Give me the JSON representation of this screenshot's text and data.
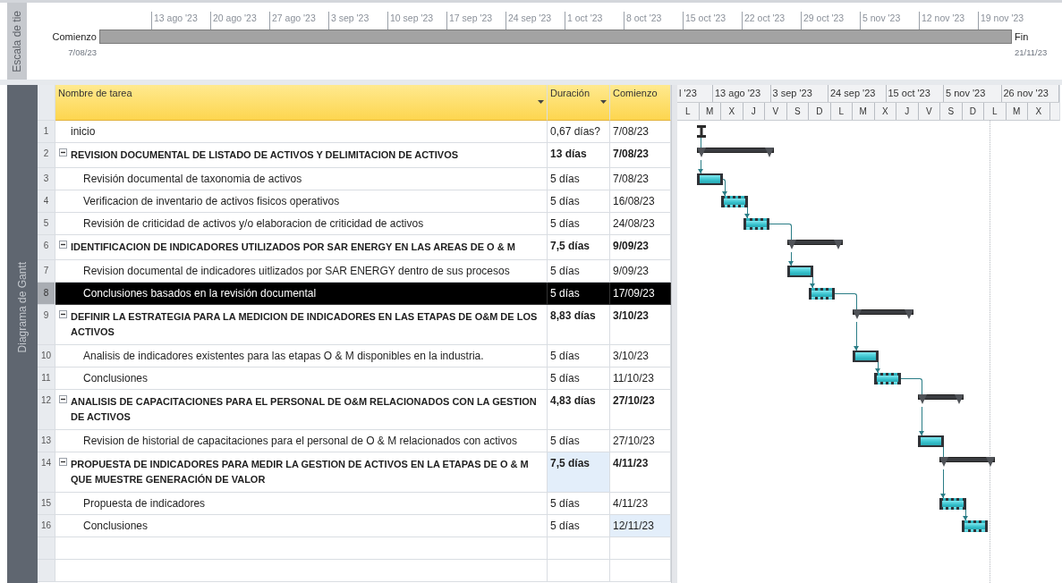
{
  "timeline": {
    "side_label": "Escala de tie",
    "start_label": "Comienzo",
    "start_date": "7/08/23",
    "end_label": "Fin",
    "end_date": "21/11/23",
    "ticks": [
      "13 ago '23",
      "20 ago '23",
      "27 ago '23",
      "3 sep '23",
      "10 sep '23",
      "17 sep '23",
      "24 sep '23",
      "1 oct '23",
      "8 oct '23",
      "15 oct '23",
      "22 oct '23",
      "29 oct '23",
      "5 nov '23",
      "12 nov '23",
      "19 nov '23"
    ]
  },
  "side_panel": {
    "label": "Diagrama de Gantt"
  },
  "table": {
    "columns": [
      {
        "label": "Nombre de tarea",
        "filter": true
      },
      {
        "label": "Duración",
        "filter": true
      },
      {
        "label": "Comienzo",
        "filter": false
      }
    ],
    "tasks": [
      {
        "id": "1",
        "name": "inicio",
        "duration": "0,67 días?",
        "start": "7/08/23",
        "kind": "milestone",
        "selected": false,
        "duration_highlighted": false,
        "start_highlighted": false
      },
      {
        "id": "2",
        "name": "REVISION DOCUMENTAL DE LISTADO DE ACTIVOS Y DELIMITACION DE ACTIVOS",
        "duration": "13 días",
        "start": "7/08/23",
        "kind": "summary",
        "expanded": true,
        "selected": false,
        "duration_highlighted": false,
        "start_highlighted": false,
        "children": [
          {
            "id": "3",
            "name": "Revisión documental de taxonomia de activos",
            "duration": "5 días",
            "start": "7/08/23",
            "kind": "task",
            "selected": false,
            "duration_highlighted": false,
            "start_highlighted": false
          },
          {
            "id": "4",
            "name": "Verificacion de inventario de activos fisicos operativos",
            "duration": "5 días",
            "start": "16/08/23",
            "kind": "hatched",
            "selected": false,
            "duration_highlighted": false,
            "start_highlighted": false
          },
          {
            "id": "5",
            "name": "Revisión de criticidad de activos y/o elaboracion de criticidad de activos",
            "duration": "5 días",
            "start": "24/08/23",
            "kind": "hatched",
            "selected": false,
            "duration_highlighted": false,
            "start_highlighted": false
          }
        ]
      },
      {
        "id": "6",
        "name": "IDENTIFICACION DE INDICADORES UTILIZADOS POR SAR ENERGY EN LAS AREAS DE O & M",
        "duration": "7,5 días",
        "start": "9/09/23",
        "kind": "summary",
        "expanded": true,
        "selected": false,
        "duration_highlighted": false,
        "start_highlighted": false,
        "children": [
          {
            "id": "7",
            "name": "Revision documental de indicadores uitlizados por SAR ENERGY dentro de sus procesos",
            "duration": "5 días",
            "start": "9/09/23",
            "kind": "task",
            "selected": false,
            "duration_highlighted": false,
            "start_highlighted": false
          },
          {
            "id": "8",
            "name": "Conclusiones basados en la revisión documental",
            "duration": "5 días",
            "start": "17/09/23",
            "kind": "hatched",
            "selected": true,
            "duration_highlighted": false,
            "start_highlighted": false
          }
        ]
      },
      {
        "id": "9",
        "name": "DEFINIR LA ESTRATEGIA PARA LA MEDICION DE INDICADORES EN LAS ETAPAS DE O&M DE LOS ACTIVOS",
        "duration": "8,83 días",
        "start": "3/10/23",
        "kind": "summary",
        "expanded": true,
        "selected": false,
        "duration_highlighted": false,
        "start_highlighted": false,
        "children": [
          {
            "id": "10",
            "name": "Analisis de indicadores existentes para las etapas O & M disponibles en la industria.",
            "duration": "5 días",
            "start": "3/10/23",
            "kind": "task",
            "selected": false,
            "duration_highlighted": false,
            "start_highlighted": false
          },
          {
            "id": "11",
            "name": "Conclusiones",
            "duration": "5 días",
            "start": "11/10/23",
            "kind": "hatched",
            "selected": false,
            "duration_highlighted": false,
            "start_highlighted": false
          }
        ]
      },
      {
        "id": "12",
        "name": "ANALISIS DE CAPACITACIONES PARA EL PERSONAL DE O&M RELACIONADOS CON LA GESTION DE ACTIVOS",
        "duration": "4,83 días",
        "start": "27/10/23",
        "kind": "summary",
        "expanded": true,
        "selected": false,
        "duration_highlighted": false,
        "start_highlighted": false,
        "children": [
          {
            "id": "13",
            "name": "Revision de historial de capacitaciones para el personal de O & M relacionados con activos",
            "duration": "5 días",
            "start": "27/10/23",
            "kind": "task",
            "selected": false,
            "duration_highlighted": false,
            "start_highlighted": false
          }
        ]
      },
      {
        "id": "14",
        "name": "PROPUESTA DE INDICADORES PARA MEDIR LA GESTION DE ACTIVOS EN LA ETAPAS DE O & M QUE MUESTRE GENERACIÓN DE VALOR",
        "duration": "7,5 días",
        "start": "4/11/23",
        "kind": "summary",
        "expanded": true,
        "selected": false,
        "duration_highlighted": true,
        "start_highlighted": false,
        "children": [
          {
            "id": "15",
            "name": "Propuesta de indicadores",
            "duration": "5 días",
            "start": "4/11/23",
            "kind": "hatched",
            "selected": false,
            "duration_highlighted": false,
            "start_highlighted": false
          },
          {
            "id": "16",
            "name": "Conclusiones",
            "duration": "5 días",
            "start": "12/11/23",
            "kind": "hatched",
            "selected": false,
            "duration_highlighted": false,
            "start_highlighted": true
          }
        ]
      }
    ]
  },
  "gantt": {
    "timescale_top": [
      "l '23",
      "13 ago '23",
      "3 sep '23",
      "24 sep '23",
      "15 oct '23",
      "5 nov '23",
      "26 nov '23"
    ],
    "timescale_bottom": [
      "L",
      "M",
      "X",
      "J",
      "V",
      "S",
      "D",
      "L",
      "M",
      "X",
      "J",
      "V",
      "S",
      "D",
      "L",
      "M",
      "X"
    ]
  }
}
